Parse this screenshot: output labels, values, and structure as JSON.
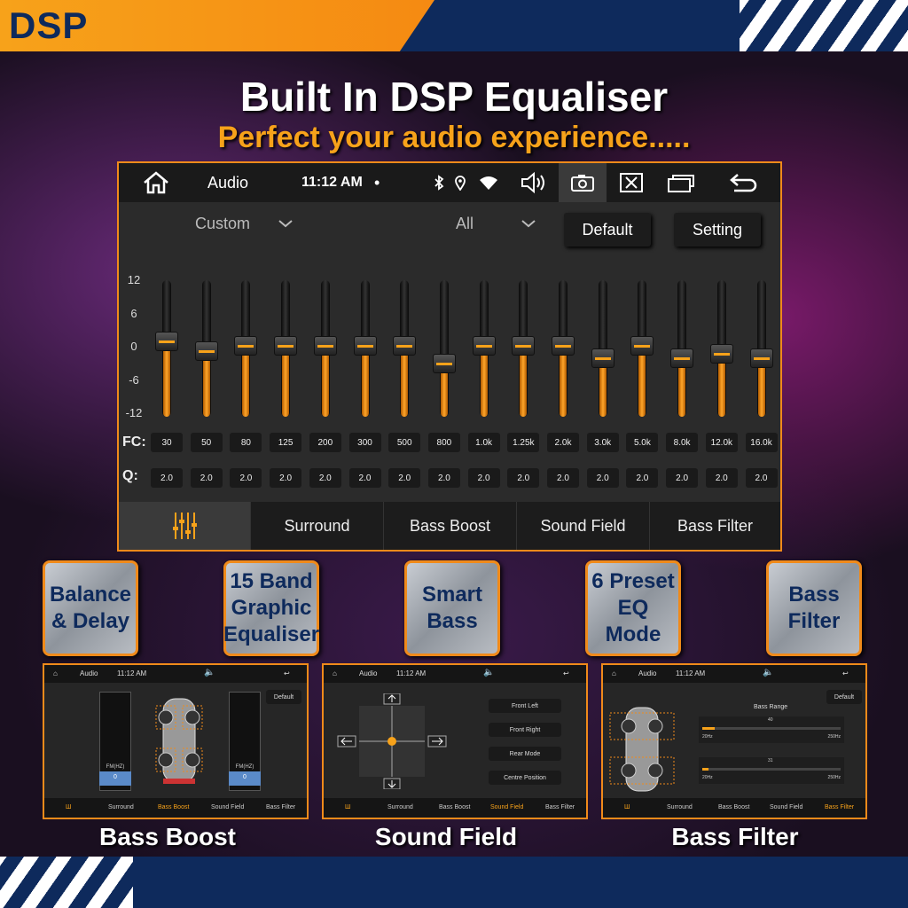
{
  "brand": {
    "title": "DSP"
  },
  "headline": {
    "title": "Built In DSP Equaliser",
    "subtitle": "Perfect your audio experience....."
  },
  "statusbar": {
    "app": "Audio",
    "time": "11:12 AM",
    "dot": "•"
  },
  "controls": {
    "preset": "Custom",
    "channel": "All",
    "default_label": "Default",
    "setting_label": "Setting"
  },
  "eq": {
    "ylabels": [
      "12",
      "6",
      "0",
      "-6",
      "-12"
    ],
    "fc_label": "FC:",
    "q_label": "Q:",
    "bands": [
      {
        "fc": "30",
        "q": "2.0",
        "gain": 1.5
      },
      {
        "fc": "50",
        "q": "2.0",
        "gain": -0.5
      },
      {
        "fc": "80",
        "q": "2.0",
        "gain": 0.5
      },
      {
        "fc": "125",
        "q": "2.0",
        "gain": 0.5
      },
      {
        "fc": "200",
        "q": "2.0",
        "gain": 0.5
      },
      {
        "fc": "300",
        "q": "2.0",
        "gain": 0.5
      },
      {
        "fc": "500",
        "q": "2.0",
        "gain": 0.5
      },
      {
        "fc": "800",
        "q": "2.0",
        "gain": -3
      },
      {
        "fc": "1.0k",
        "q": "2.0",
        "gain": 0.5
      },
      {
        "fc": "1.25k",
        "q": "2.0",
        "gain": 0.5
      },
      {
        "fc": "2.0k",
        "q": "2.0",
        "gain": 0.5
      },
      {
        "fc": "3.0k",
        "q": "2.0",
        "gain": -2
      },
      {
        "fc": "5.0k",
        "q": "2.0",
        "gain": 0.5
      },
      {
        "fc": "8.0k",
        "q": "2.0",
        "gain": -2
      },
      {
        "fc": "12.0k",
        "q": "2.0",
        "gain": -1
      },
      {
        "fc": "16.0k",
        "q": "2.0",
        "gain": -2
      }
    ]
  },
  "tabs": [
    "Surround",
    "Bass Boost",
    "Sound Field",
    "Bass Filter"
  ],
  "features": [
    "Balance & Delay",
    "15 Band Graphic Equaliser",
    "Smart Bass",
    "6 Preset EQ Mode",
    "Bass Filter"
  ],
  "mini_common": {
    "app": "Audio",
    "time": "11:12 AM",
    "tabs": [
      "Surround",
      "Bass Boost",
      "Sound Field",
      "Bass Filter"
    ]
  },
  "mini_boost": {
    "default_label": "Default",
    "fm_label": "FM(HZ)",
    "val_left": "0",
    "val_right": "0"
  },
  "mini_field": {
    "buttons": [
      "Front Left",
      "Front Right",
      "Rear Mode",
      "Centre Position"
    ]
  },
  "mini_filter": {
    "default_label": "Default",
    "range_title": "Bass Range",
    "s1_val": "40",
    "s2_val": "31",
    "min": "20Hz",
    "max": "250Hz"
  },
  "captions": [
    "Bass Boost",
    "Sound Field",
    "Bass Filter"
  ],
  "colors": {
    "accent": "#f7a21a",
    "navy": "#0e2a5c"
  }
}
